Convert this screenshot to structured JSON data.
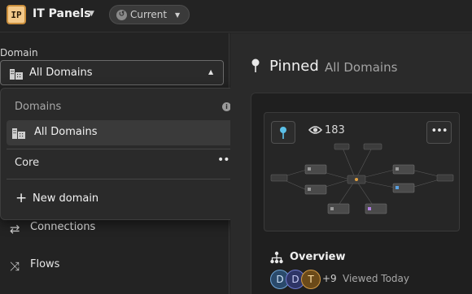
{
  "app": {
    "logo_text": "IP",
    "title": "IT Panels",
    "environment": "Current"
  },
  "sidebar": {
    "domain_label": "Domain",
    "selected_domain": "All Domains",
    "nav_items": [
      {
        "label": "Connections",
        "icon": "arrows-swap-icon"
      },
      {
        "label": "Flows",
        "icon": "shuffle-icon"
      }
    ]
  },
  "dropdown": {
    "header": "Domains",
    "items": [
      {
        "label": "All Domains",
        "selected": true
      },
      {
        "label": "Core",
        "selected": false
      }
    ],
    "more_label": "•••",
    "new_label": "New domain",
    "plus": "+"
  },
  "main": {
    "title": "Pinned",
    "subtitle": "All Domains",
    "card": {
      "views": "183",
      "more_label": "•••",
      "title": "Overview",
      "avatars": [
        "D",
        "D",
        "T"
      ],
      "extra_count": "+9",
      "viewed": "Viewed Today"
    }
  },
  "colors": {
    "background": "#222222",
    "panel": "#2a2a2a",
    "logo_bg": "#f3c98a",
    "pin_accent": "#5bc0e8"
  }
}
